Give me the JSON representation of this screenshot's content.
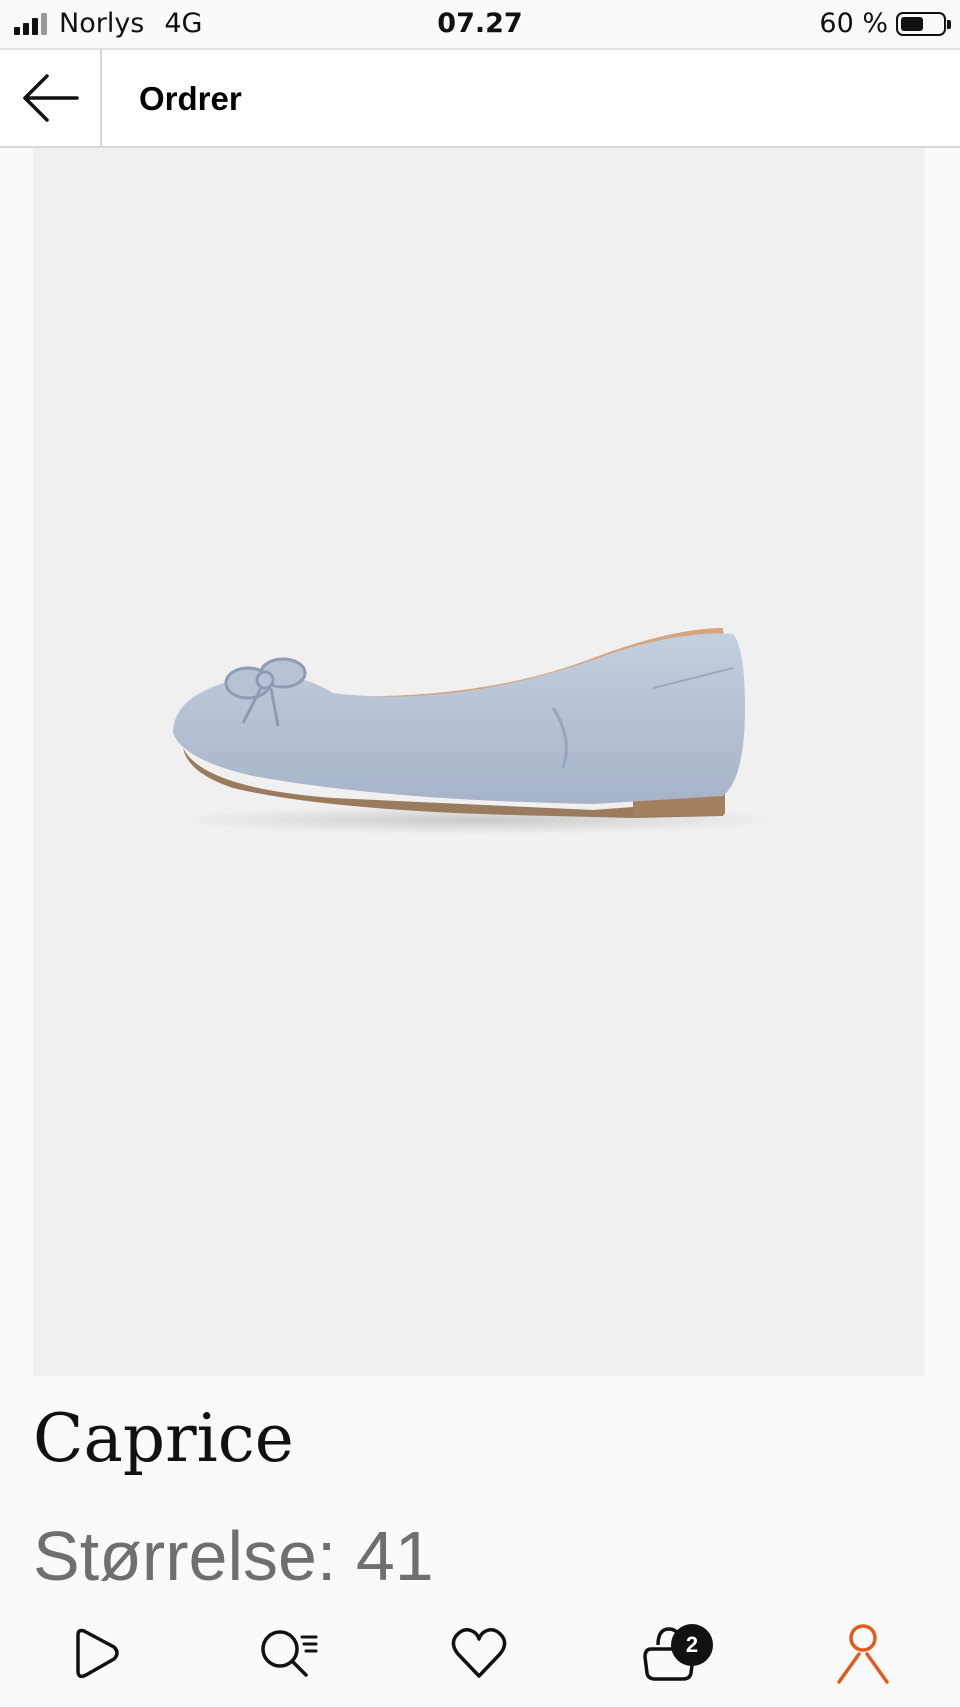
{
  "status_bar": {
    "carrier": "Norlys",
    "network": "4G",
    "time": "07.27",
    "battery_percent": "60 %",
    "battery_level": 0.6
  },
  "header": {
    "back_icon": "arrow-left-icon",
    "title": "Ordrer"
  },
  "product": {
    "image_subject": "light blue ballet flat shoe with bow",
    "brand": "Caprice",
    "size_text": "Størrelse: 41"
  },
  "bottom_nav": {
    "items": [
      {
        "icon": "play-icon"
      },
      {
        "icon": "search-list-icon"
      },
      {
        "icon": "heart-icon"
      },
      {
        "icon": "bag-icon",
        "badge": "2"
      },
      {
        "icon": "profile-icon",
        "active": true
      }
    ],
    "active_color": "#e35a1e"
  },
  "colors": {
    "background": "#fafafa",
    "image_background": "#f0f0f0",
    "shoe": "#b3bfd3",
    "accent": "#e35a1e"
  }
}
